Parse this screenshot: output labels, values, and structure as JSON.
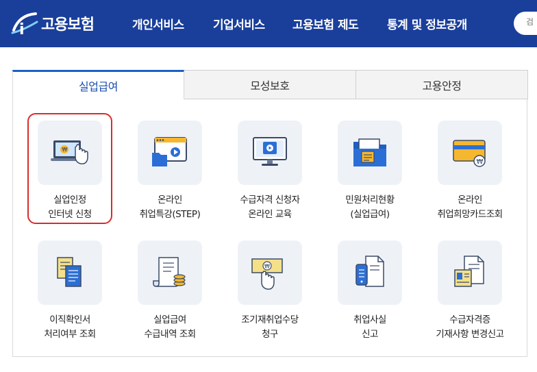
{
  "header": {
    "logo_text": "고용보험",
    "nav": [
      "개인서비스",
      "기업서비스",
      "고용보험 제도",
      "통계 및 정보공개"
    ],
    "search_placeholder": "검"
  },
  "tabs": [
    {
      "label": "실업급여",
      "active": true
    },
    {
      "label": "모성보호",
      "active": false
    },
    {
      "label": "고용안정",
      "active": false
    }
  ],
  "services": [
    {
      "line1": "실업인정",
      "line2": "인터넷 신청",
      "icon": "laptop-hand-icon",
      "highlighted": true
    },
    {
      "line1": "온라인",
      "line2": "취업특강(STEP)",
      "icon": "video-folder-icon",
      "highlighted": false
    },
    {
      "line1": "수급자격 신청자",
      "line2": "온라인 교육",
      "icon": "monitor-play-icon",
      "highlighted": false
    },
    {
      "line1": "민원처리현황",
      "line2": "(실업급여)",
      "icon": "folder-document-icon",
      "highlighted": false
    },
    {
      "line1": "온라인",
      "line2": "취업희망카드조회",
      "icon": "card-coin-icon",
      "highlighted": false
    },
    {
      "line1": "이직확인서",
      "line2": "처리여부 조회",
      "icon": "documents-icon",
      "highlighted": false
    },
    {
      "line1": "실업급여",
      "line2": "수급내역 조회",
      "icon": "scroll-coins-icon",
      "highlighted": false
    },
    {
      "line1": "조기재취업수당",
      "line2": "청구",
      "icon": "bill-hand-icon",
      "highlighted": false
    },
    {
      "line1": "취업사실",
      "line2": "신고",
      "icon": "phone-document-icon",
      "highlighted": false
    },
    {
      "line1": "수급자격증",
      "line2": "기재사항 변경신고",
      "icon": "certificate-icon",
      "highlighted": false
    }
  ],
  "colors": {
    "header_bg": "#1a3f9b",
    "active_tab": "#1a5fc4",
    "highlight_border": "#d92b2b",
    "icon_bg": "#eef2f7"
  }
}
